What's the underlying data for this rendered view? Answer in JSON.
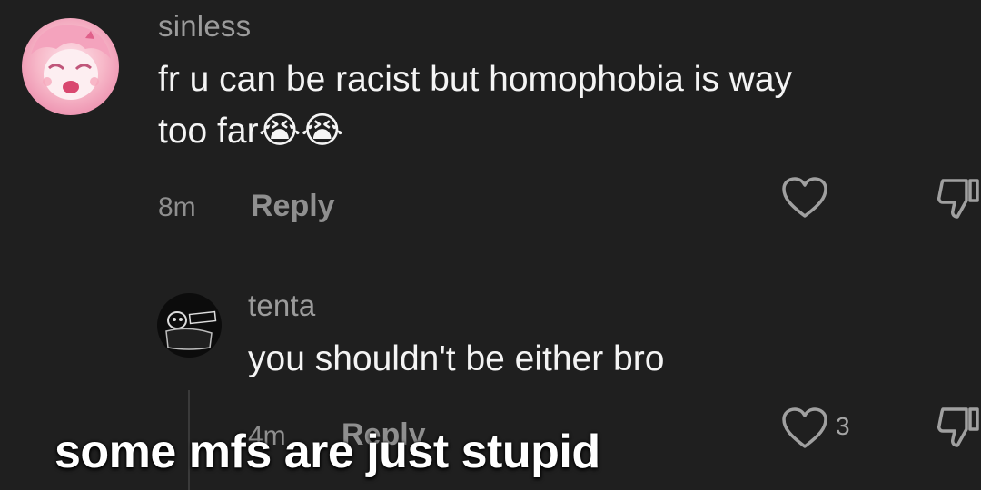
{
  "comment": {
    "username": "sinless",
    "text_line1": "fr u can be racist but homophobia is way",
    "text_line2": "too far",
    "emoji": "😭😭",
    "time": "8m",
    "reply_label": "Reply",
    "like_icon": "heart-icon",
    "dislike_icon": "thumbs-down-icon"
  },
  "reply": {
    "username": "tenta",
    "text": "you shouldn't be either bro",
    "time": "4m",
    "reply_label": "Reply",
    "like_count": "3",
    "like_icon": "heart-icon",
    "dislike_icon": "thumbs-down-icon"
  },
  "caption": {
    "text": "some mfs are just stupid"
  }
}
